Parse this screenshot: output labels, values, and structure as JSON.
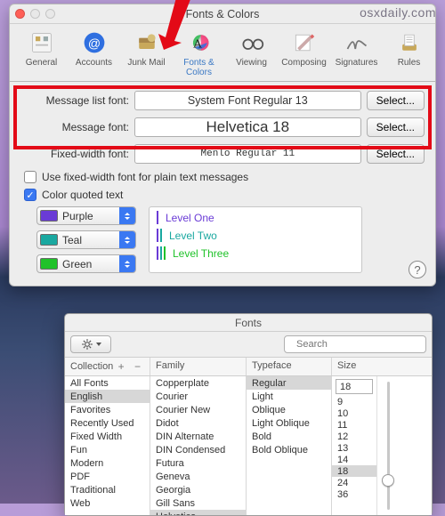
{
  "watermark": "osxdaily.com",
  "win1": {
    "title": "Fonts & Colors",
    "tabs": [
      {
        "label": "General"
      },
      {
        "label": "Accounts"
      },
      {
        "label": "Junk Mail"
      },
      {
        "label": "Fonts & Colors"
      },
      {
        "label": "Viewing"
      },
      {
        "label": "Composing"
      },
      {
        "label": "Signatures"
      },
      {
        "label": "Rules"
      }
    ],
    "rows": {
      "msg_list_label": "Message list font:",
      "msg_list_value": "System Font Regular 13",
      "msg_label": "Message font:",
      "msg_value": "Helvetica 18",
      "fixed_label": "Fixed-width font:",
      "fixed_value": "Menlo Regular 11",
      "select_btn": "Select..."
    },
    "checks": {
      "use_fixed": "Use fixed-width font for plain text messages",
      "color_quoted": "Color quoted text"
    },
    "colors": [
      {
        "name": "Purple",
        "hex": "#6a3bd6",
        "level_label": "Level One"
      },
      {
        "name": "Teal",
        "hex": "#1aa8a0",
        "level_label": "Level Two"
      },
      {
        "name": "Green",
        "hex": "#20c22a",
        "level_label": "Level Three"
      }
    ]
  },
  "win2": {
    "title": "Fonts",
    "search_placeholder": "Search",
    "headers": {
      "collection": "Collection",
      "family": "Family",
      "typeface": "Typeface",
      "size": "Size"
    },
    "collections": [
      "All Fonts",
      "English",
      "Favorites",
      "Recently Used",
      "Fixed Width",
      "Fun",
      "Modern",
      "PDF",
      "Traditional",
      "Web"
    ],
    "collections_selected": "English",
    "families": [
      "Copperplate",
      "Courier",
      "Courier New",
      "Didot",
      "DIN Alternate",
      "DIN Condensed",
      "Futura",
      "Geneva",
      "Georgia",
      "Gill Sans",
      "Helvetica"
    ],
    "families_selected": "Helvetica",
    "typefaces": [
      "Regular",
      "Light",
      "Oblique",
      "Light Oblique",
      "Bold",
      "Bold Oblique"
    ],
    "typefaces_selected": "Regular",
    "size_current": "18",
    "sizes": [
      "9",
      "10",
      "11",
      "12",
      "13",
      "14",
      "18",
      "24",
      "36"
    ],
    "size_selected": "18"
  }
}
